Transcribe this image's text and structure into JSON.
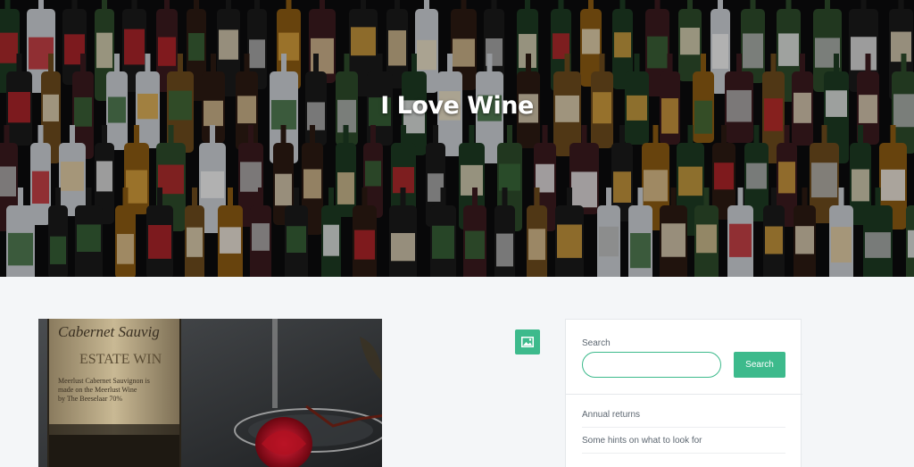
{
  "hero": {
    "title": "I Love Wine"
  },
  "sidebar": {
    "search_label": "Search",
    "search_placeholder": "",
    "search_button": "Search",
    "items": [
      {
        "label": "Annual returns"
      },
      {
        "label": "Some hints on what to look for"
      }
    ]
  },
  "colors": {
    "accent": "#3dba8c",
    "hero_bg": "#0b0b0d",
    "page_bg": "#f4f6f8"
  },
  "icons": {
    "format": "image-icon"
  }
}
